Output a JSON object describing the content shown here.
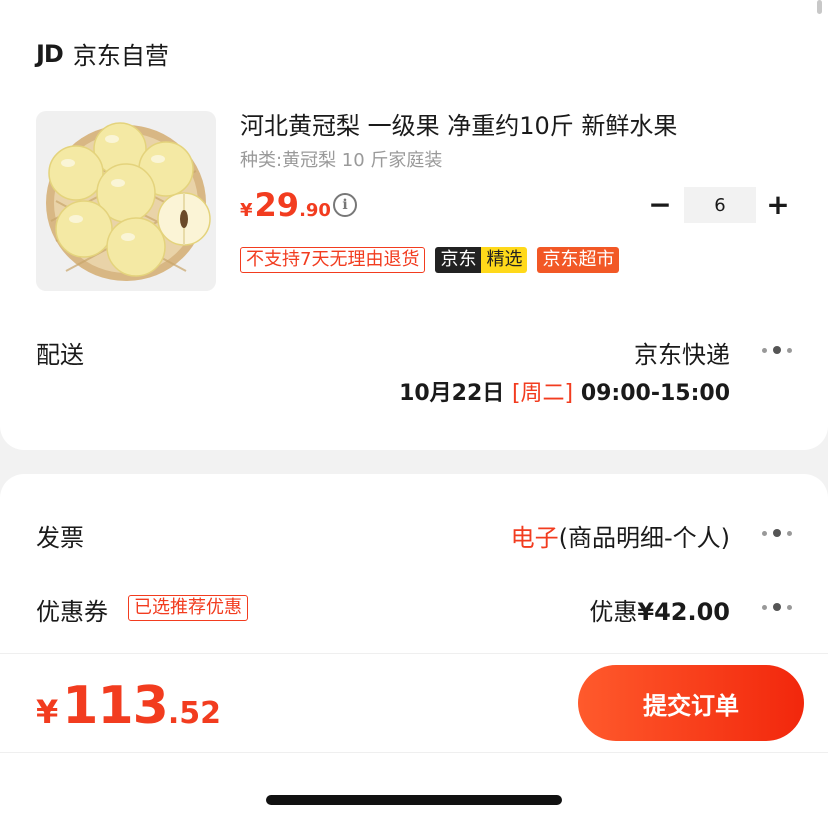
{
  "store": {
    "logo": "JD",
    "name": "京东自营"
  },
  "product": {
    "image_icon": "pear-basket-image",
    "title": "河北黄冠梨 一级果 净重约10斤  新鲜水果",
    "variant": "种类:黄冠梨 10 斤家庭装",
    "price": {
      "currency": "¥",
      "integer": "29",
      "decimal": ".90"
    },
    "info_icon": "i",
    "quantity": {
      "minus": "−",
      "value": "6",
      "plus": "+"
    },
    "tags": {
      "return_policy": "不支持7天无理由退货",
      "jx_part1": "京东",
      "jx_part2": "精选",
      "supermarket": "京东超市"
    }
  },
  "delivery": {
    "label": "配送",
    "method": "京东快递",
    "date": "10月22日",
    "weekday": "[周二]",
    "time": "09:00-15:00"
  },
  "invoice": {
    "label": "发票",
    "type": "电子",
    "detail": "(商品明细-个人)"
  },
  "coupon": {
    "label": "优惠券",
    "tag": "已选推荐优惠",
    "prefix": "优惠",
    "amount": "¥42.00"
  },
  "footer": {
    "total": {
      "currency": "¥",
      "integer": "113",
      "decimal": ".52"
    },
    "submit_label": "提交订单"
  },
  "colors": {
    "accent": "#f23c1f",
    "jx_yellow": "#ffd91a",
    "supermarket": "#f25826"
  }
}
